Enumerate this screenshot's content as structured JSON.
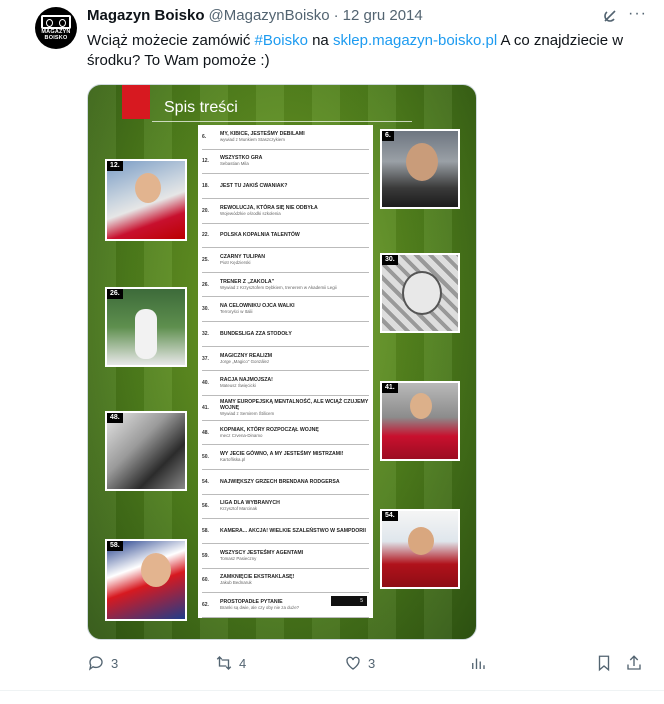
{
  "tweet": {
    "author_name": "Magazyn Boisko",
    "handle": "@MagazynBoisko",
    "separator": "·",
    "date": "12 gru 2014",
    "avatar_text": "MAGAZYN BOISKO",
    "text_part1": "Wciąż możecie zamówić ",
    "hashtag": "#Boisko",
    "text_part2": " na ",
    "link": "sklep.magazyn-boisko.pl",
    "text_part3": " A co znajdziecie w środku? To Wam pomoże :)",
    "more_icon": "more-icon",
    "grok_icon": "grok-icon"
  },
  "media": {
    "title": "Spis treści",
    "page_number": "5",
    "toc": [
      {
        "num": "6.",
        "title": "MY, KIBICE, JESTEŚMY DEBILAMI",
        "author": "wywiad z Munkiem Staszczykiem"
      },
      {
        "num": "12.",
        "title": "WSZYSTKO GRA",
        "author": "Sebastian Mila"
      },
      {
        "num": "18.",
        "title": "JEST TU JAKIŚ CWANIAK?",
        "author": ""
      },
      {
        "num": "20.",
        "title": "REWOLUCJA, KTÓRA SIĘ NIE ODBYŁA",
        "author": "Wojewódzkie ośrodki szkolenia"
      },
      {
        "num": "22.",
        "title": "POLSKA KOPALNIA TALENTÓW",
        "author": ""
      },
      {
        "num": "25.",
        "title": "CZARNY TULIPAN",
        "author": "Piotr Kędzierski"
      },
      {
        "num": "26.",
        "title": "TRENER Z „ZAKOLA\"",
        "author": "Wywiad z Krzysztofem Dębkiem, trenerem w Akademii Legii"
      },
      {
        "num": "30.",
        "title": "NA CELOWNIKU OJCA WALKI",
        "author": "Terroryści w Italii"
      },
      {
        "num": "32.",
        "title": "BUNDESLIGA ZZA STODOŁY",
        "author": ""
      },
      {
        "num": "37.",
        "title": "MAGICZNY REALIZM",
        "author": "Jorge „Magico\" González"
      },
      {
        "num": "40.",
        "title": "RACJA NAJMOJSZA!",
        "author": "Mateusz Święcicki"
      },
      {
        "num": "41.",
        "title": "MAMY EUROPEJSKĄ MENTALNOŚĆ, ALE WCIĄŻ CZUJEMY WOJNĘ",
        "author": "Wywiad z Semirem Štilicem"
      },
      {
        "num": "48.",
        "title": "KOPNIAK, KTÓRY ROZPOCZĄŁ WOJNĘ",
        "author": "mecz Crvena-Dinamo"
      },
      {
        "num": "50.",
        "title": "WY JECIE GÓWNO, A MY JESTEŚMY MISTRZAMI!",
        "author": "Kartofliska.pl"
      },
      {
        "num": "54.",
        "title": "NAJWIĘKSZY GRZECH BRENDANA RODGERSA",
        "author": ""
      },
      {
        "num": "56.",
        "title": "LIGA DLA WYBRANYCH",
        "author": "Krzysztof Marcinak"
      },
      {
        "num": "58.",
        "title": "KAMERA... AKCJA! WIELKIE SZALEŃSTWO W SAMPDORII",
        "author": ""
      },
      {
        "num": "59.",
        "title": "WSZYSCY JESTEŚMY AGENTAMI",
        "author": "Tomasz Pasieczny"
      },
      {
        "num": "60.",
        "title": "ZAMKNIĘCIE EKSTRAKLASĘ!",
        "author": "Jakub Bednaruk"
      },
      {
        "num": "62.",
        "title": "PROSTOPADŁE PYTANIE",
        "author": "Branki są dwie, ale czy oby nie za duże?"
      }
    ],
    "thumbs": [
      {
        "badge": "12.",
        "label": "thumb-12"
      },
      {
        "badge": "6.",
        "label": "thumb-6"
      },
      {
        "badge": "30.",
        "label": "thumb-30"
      },
      {
        "badge": "26.",
        "label": "thumb-26"
      },
      {
        "badge": "41.",
        "label": "thumb-41"
      },
      {
        "badge": "48.",
        "label": "thumb-48"
      },
      {
        "badge": "54.",
        "label": "thumb-54"
      },
      {
        "badge": "58.",
        "label": "thumb-58"
      }
    ]
  },
  "actions": {
    "reply_count": "3",
    "retweet_count": "4",
    "like_count": "3",
    "views_icon": "views-icon",
    "bookmark_icon": "bookmark-icon",
    "share_icon": "share-icon"
  }
}
